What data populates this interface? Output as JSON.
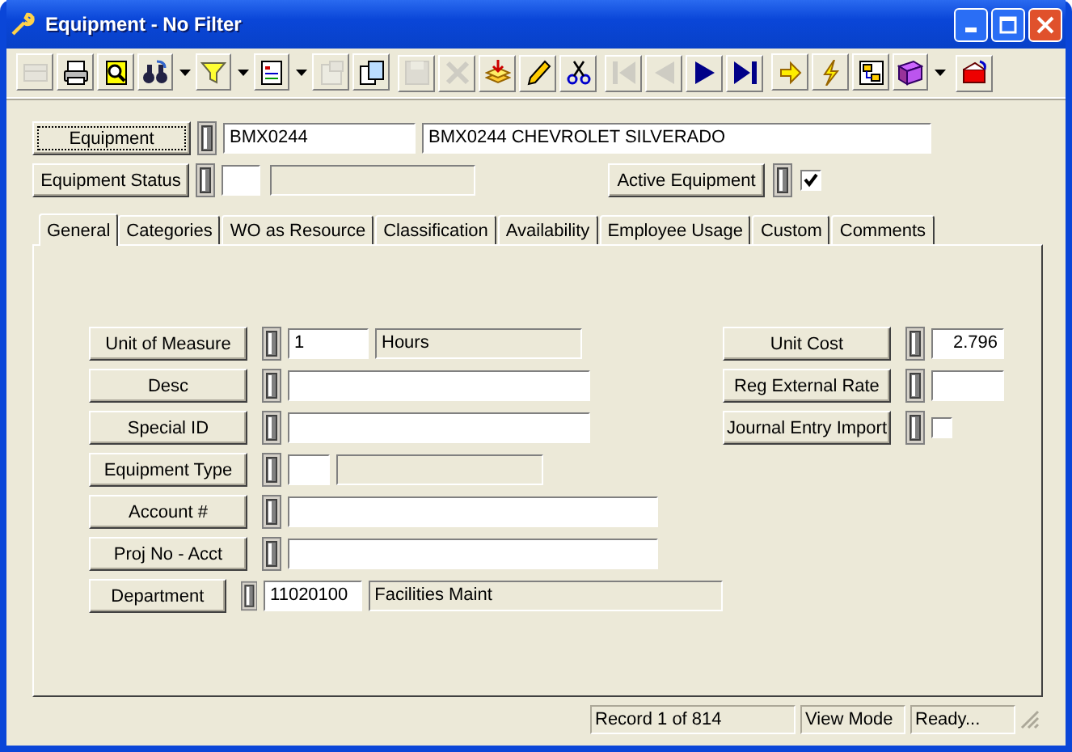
{
  "window": {
    "title": "Equipment - No Filter"
  },
  "toolbar": [
    [
      {
        "disabled": true,
        "dropdown": false
      },
      {
        "disabled": false,
        "dropdown": false
      },
      {
        "disabled": false,
        "dropdown": false
      },
      {
        "disabled": false,
        "dropdown": true
      },
      {
        "disabled": false,
        "dropdown": true
      },
      {
        "disabled": false,
        "dropdown": true
      },
      {
        "disabled": true,
        "dropdown": false
      },
      {
        "disabled": false,
        "dropdown": false
      }
    ],
    [
      {
        "disabled": true,
        "dropdown": false
      },
      {
        "disabled": true,
        "dropdown": false
      },
      {
        "disabled": false,
        "dropdown": false
      },
      {
        "disabled": false,
        "dropdown": false
      },
      {
        "disabled": false,
        "dropdown": false
      }
    ],
    [
      {
        "disabled": true,
        "dropdown": false
      },
      {
        "disabled": true,
        "dropdown": false
      },
      {
        "disabled": false,
        "dropdown": false
      },
      {
        "disabled": false,
        "dropdown": false
      }
    ],
    [
      {
        "disabled": false,
        "dropdown": false
      },
      {
        "disabled": false,
        "dropdown": false
      },
      {
        "disabled": false,
        "dropdown": false
      },
      {
        "disabled": false,
        "dropdown": true
      }
    ],
    [
      {
        "disabled": false,
        "dropdown": false
      }
    ]
  ],
  "header": {
    "equipment": {
      "label": "Equipment",
      "code": "BMX0244",
      "description": "BMX0244 CHEVROLET SILVERADO"
    },
    "status": {
      "label": "Equipment Status"
    },
    "active": {
      "label": "Active Equipment",
      "checked": true
    }
  },
  "tabs": [
    {
      "label": "General",
      "selected": true
    },
    {
      "label": "Categories",
      "selected": false
    },
    {
      "label": "WO as Resource",
      "selected": false
    },
    {
      "label": "Classification",
      "selected": false
    },
    {
      "label": "Availability",
      "selected": false
    },
    {
      "label": "Employee Usage",
      "selected": false
    },
    {
      "label": "Custom",
      "selected": false
    },
    {
      "label": "Comments",
      "selected": false
    }
  ],
  "left_fields": [
    {
      "kind": "code_desc",
      "label": "Unit of Measure",
      "code": "1",
      "description": "Hours"
    },
    {
      "kind": "text",
      "label": "Desc"
    },
    {
      "kind": "text",
      "label": "Special ID"
    },
    {
      "kind": "code_desc",
      "label": "Equipment Type"
    },
    {
      "kind": "text",
      "label": "Account #"
    },
    {
      "kind": "text",
      "label": "Proj No - Acct"
    },
    {
      "kind": "code_desc",
      "label": "Department",
      "code": "11020100",
      "description": "Facilities Maint"
    }
  ],
  "right_fields": [
    {
      "kind": "number",
      "label": "Unit Cost",
      "value": "2.796"
    },
    {
      "kind": "number",
      "label": "Reg External Rate"
    },
    {
      "kind": "check",
      "label": "Journal Entry Import",
      "checked": false
    }
  ],
  "status_bar": {
    "record": "Record 1 of 814",
    "mode": "View Mode",
    "state": "Ready..."
  }
}
